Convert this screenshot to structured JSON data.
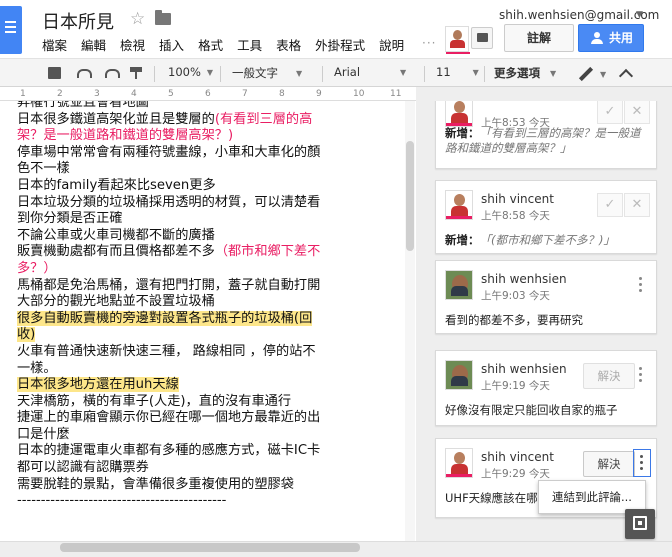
{
  "doc": {
    "title": "日本所見",
    "menu": [
      "檔案",
      "編輯",
      "檢視",
      "插入",
      "格式",
      "工具",
      "表格",
      "外掛程式",
      "說明"
    ],
    "more_dots": "···"
  },
  "account": {
    "email": "shih.wenhsien@gmail.com",
    "comment_label": "註解",
    "share_label": "共用"
  },
  "toolbar": {
    "zoom": "100%",
    "style": "一般文字",
    "font": "Arial",
    "size": "11",
    "more": "更多選項"
  },
  "ruler": {
    "ticks": [
      "1",
      "2",
      "3",
      "4",
      "5",
      "6",
      "7",
      "8",
      "9",
      "10",
      "11"
    ]
  },
  "body_lines": [
    {
      "text": "昇權行號並且會看地圖",
      "pink": ""
    },
    {
      "text": "日本很多鐵道高架化並且是雙層的",
      "pink": "(有看到三層的高架？是一般道路和鐵道的雙層高架？)"
    },
    {
      "text": "停車場中常常會有兩種符號畫線，小車和大車化的顏色不一樣",
      "pink": ""
    },
    {
      "text": "日本的family看起來比seven更多",
      "pink": ""
    },
    {
      "text": "日本垃圾分類的垃圾桶採用透明的材質，可以清楚看到你分類是否正確",
      "pink": ""
    },
    {
      "text": "不論公車或火車司機都不斷的廣播",
      "pink": ""
    },
    {
      "text": "販賣機動處都有而且價格都差不多",
      "pink": "（都市和鄉下差不多？）"
    },
    {
      "text": "馬桶都是免治馬桶，還有把門打開，蓋子就自動打開",
      "pink": ""
    },
    {
      "text": "大部分的觀光地點並不設置垃圾桶",
      "pink": ""
    },
    {
      "text": "很多自動販賣機的旁邊對設置各式瓶子的垃圾桶(回收)",
      "pink": ""
    },
    {
      "text": "火車有普通快速新快速三種， 路線相同 ，停的站不一樣。",
      "pink": ""
    },
    {
      "text": "日本很多地方還在用uh天線",
      "pink": ""
    },
    {
      "text": "天津橋筋，橫的有車子(人走)，直的沒有車通行",
      "pink": ""
    },
    {
      "text": "捷運上的車廂會顯示你已經在哪一個地方最靠近的出口是什麼",
      "pink": ""
    },
    {
      "text": "日本的捷運電車火車都有多種的感應方式，磁卡IC卡都可以認識有認購票券",
      "pink": ""
    },
    {
      "text": "需要脫鞋的景點，會準備很多重複使用的塑膠袋",
      "pink": ""
    },
    {
      "text": "--------------------------------------------",
      "pink": ""
    }
  ],
  "comments": [
    {
      "name": "",
      "time": "上午8:53 今天",
      "label": "新增：",
      "quote": "「有看到三層的高架？是一般道路和鐵道的雙層高架？」"
    },
    {
      "name": "shih vincent",
      "time": "上午8:58 今天",
      "label": "新增：",
      "quote": "「(都市和鄉下差不多？)」"
    },
    {
      "name": "shih wenhsien",
      "time": "上午9:03 今天",
      "text": "看到的都差不多，要再研究"
    },
    {
      "name": "shih wenhsien",
      "time": "上午9:19 今天",
      "text": "好像沒有限定只能回收自家的瓶子",
      "resolve": "解決"
    },
    {
      "name": "shih vincent",
      "time": "上午9:29 今天",
      "text": "UHF天線應該在哪",
      "resolve": "解決"
    }
  ],
  "popup": {
    "label": "連結到此評論..."
  },
  "colors": {
    "accent": "#4a8af4",
    "pink": "#e91e63",
    "highlight": "#fde68a"
  }
}
